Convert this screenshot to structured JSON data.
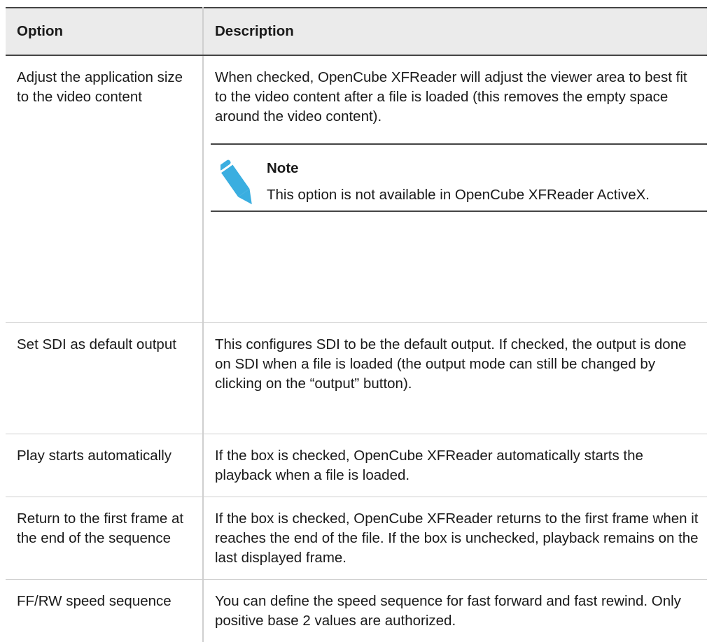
{
  "table": {
    "headers": [
      "Option",
      "Description"
    ],
    "rows": [
      {
        "option": "Adjust the application size to the video content",
        "description": "When checked, OpenCube XFReader will adjust the viewer area to best fit to the video content after a file is loaded (this removes the empty space around the video content).",
        "note": {
          "title": "Note",
          "text": "This option is not available in OpenCube XFReader ActiveX."
        }
      },
      {
        "option": "Set SDI as default output",
        "description": "This configures SDI to be the default output. If checked, the output is done on SDI when a file is loaded (the output mode can still be changed by clicking on the “output” button)."
      },
      {
        "option": "Play starts automatically",
        "description": "If the box is checked, OpenCube XFReader automatically starts the playback when a file is loaded."
      },
      {
        "option": "Return to the first frame at the end of the sequence",
        "description": "If the box is checked, OpenCube XFReader returns to the first frame when it reaches the end of the file. If the box is unchecked, playback remains on the last displayed frame."
      },
      {
        "option": "FF/RW speed sequence",
        "description": "You can define the speed sequence for fast forward and fast rewind. Only positive base 2 values are authorized."
      }
    ]
  },
  "colors": {
    "header_bg": "#ebebeb",
    "rule_dark": "#444444",
    "rule_light": "#cfcfcf",
    "note_icon": "#3aaee0"
  },
  "icons": {
    "note": "pencil-icon"
  }
}
